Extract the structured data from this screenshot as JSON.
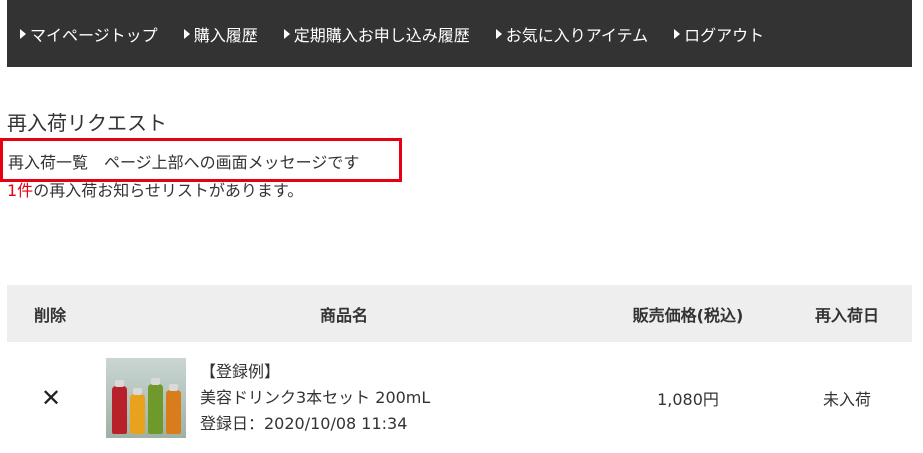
{
  "nav": {
    "items": [
      {
        "label": "マイページトップ"
      },
      {
        "label": "購入履歴"
      },
      {
        "label": "定期購入お申し込み履歴"
      },
      {
        "label": "お気に入りアイテム"
      },
      {
        "label": "ログアウト"
      }
    ]
  },
  "page": {
    "title": "再入荷リクエスト",
    "notice": "再入荷一覧　ページ上部への画面メッセージです",
    "count_number": "1件",
    "count_text": "の再入荷お知らせリストがあります。"
  },
  "table": {
    "headers": {
      "delete": "削除",
      "product": "商品名",
      "price": "販売価格(税込)",
      "restock": "再入荷日"
    },
    "rows": [
      {
        "delete_symbol": "✕",
        "tag": "【登録例】",
        "name": "美容ドリンク3本セット 200mL",
        "registered": "登録日：2020/10/08 11:34",
        "price": "1,080円",
        "restock": "未入荷"
      }
    ]
  },
  "colors": {
    "nav_bg": "#333333",
    "accent_red": "#e60012",
    "header_bg": "#eeeeee"
  },
  "icons": [
    "triangle-right-icon",
    "delete-x-icon",
    "product-thumbnail"
  ]
}
